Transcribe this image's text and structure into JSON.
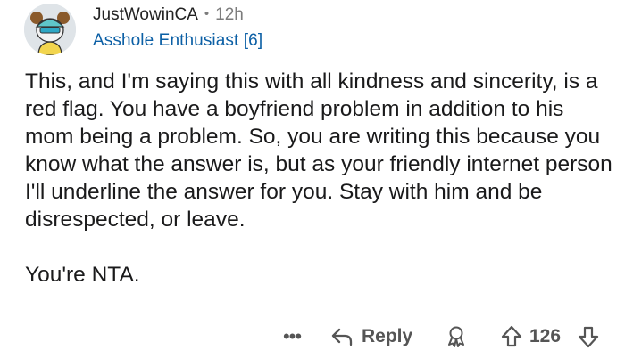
{
  "comment": {
    "author": "JustWowinCA",
    "separator": "•",
    "age": "12h",
    "flair": "Asshole Enthusiast [6]",
    "paragraphs": [
      "This, and I'm saying this with all kindness and sincerity, is a red flag. You have a boyfriend problem in addition to his mom being a problem. So, you are writing this because you know what the answer is, but as your friendly internet person I'll underline the answer for you. Stay with him and be disrespected, or leave.",
      "You're NTA."
    ]
  },
  "actions": {
    "more_label": "•••",
    "reply_label": "Reply",
    "score": "126"
  },
  "icons": {
    "avatar": "avatar-snoo-icon",
    "reply": "reply-arrow-icon",
    "award": "award-icon",
    "upvote": "upvote-arrow-icon",
    "downvote": "downvote-arrow-icon"
  },
  "colors": {
    "flair": "#0b5fa5",
    "meta_gray": "#7c7c7c",
    "action_gray": "#555555",
    "text": "#1a1a1b"
  }
}
